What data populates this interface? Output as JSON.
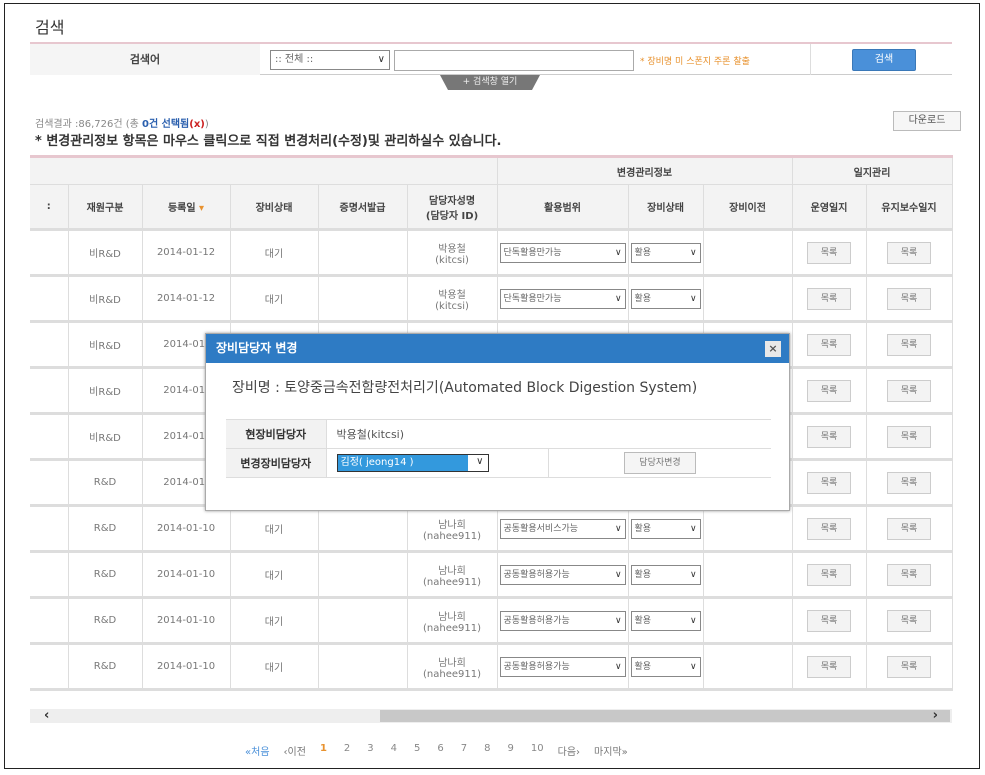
{
  "page_title": "검색",
  "search": {
    "label": "검색어",
    "scope": ":: 전체 ::",
    "value": "",
    "hint": "* 장비명 미 스폰지 주론 찰출",
    "button": "검색",
    "toggle": "+ 검색창 열기"
  },
  "result": {
    "prefix": "검색결과 :86,726건 (총 ",
    "count": "0건 선택됨",
    "x": "(x)",
    "suffix": ")"
  },
  "note": "* 변경관리정보 항목은 마우스 클릭으로 직접 변경처리(수정)및 관리하실수 있습니다.",
  "download": "다운로드",
  "table": {
    "groups": {
      "change": "변경관리정보",
      "log": "일지관리"
    },
    "columns": [
      "재원구분",
      "등록일",
      "장비상태",
      "증명서발급",
      "담당자성명",
      "(담당자 ID)",
      "활용범위",
      "장비상태",
      "장비이전",
      "운영일지",
      "유지보수일지"
    ],
    "sort_icon": "▾",
    "log_button": "목록",
    "rows": [
      {
        "fund": "비R&D",
        "date": "2014-01-12",
        "status": "대기",
        "name": "박용철",
        "id": "(kitcsi)",
        "scope": "단독활용만가능",
        "state": "활용"
      },
      {
        "fund": "비R&D",
        "date": "2014-01-12",
        "status": "대기",
        "name": "박용철",
        "id": "(kitcsi)",
        "scope": "단독활용만가능",
        "state": "활용"
      },
      {
        "fund": "비R&D",
        "date": "2014-01-",
        "status": "",
        "name": "",
        "id": "",
        "scope": "",
        "state": ""
      },
      {
        "fund": "비R&D",
        "date": "2014-01-",
        "status": "",
        "name": "",
        "id": "",
        "scope": "",
        "state": ""
      },
      {
        "fund": "비R&D",
        "date": "2014-01-",
        "status": "",
        "name": "",
        "id": "",
        "scope": "",
        "state": ""
      },
      {
        "fund": "R&D",
        "date": "2014-01-",
        "status": "",
        "name": "",
        "id": "",
        "scope": "",
        "state": ""
      },
      {
        "fund": "R&D",
        "date": "2014-01-10",
        "status": "대기",
        "name": "남나희",
        "id": "(nahee911)",
        "scope": "공동활용서비스가능",
        "state": "활용"
      },
      {
        "fund": "R&D",
        "date": "2014-01-10",
        "status": "대기",
        "name": "남나희",
        "id": "(nahee911)",
        "scope": "공동활용허용가능",
        "state": "활용"
      },
      {
        "fund": "R&D",
        "date": "2014-01-10",
        "status": "대기",
        "name": "남나희",
        "id": "(nahee911)",
        "scope": "공동활용허용가능",
        "state": "활용"
      },
      {
        "fund": "R&D",
        "date": "2014-01-10",
        "status": "대기",
        "name": "남나희",
        "id": "(nahee911)",
        "scope": "공동활용허용가능",
        "state": "활용"
      }
    ]
  },
  "pager": {
    "first": "«처음",
    "prev": "‹이전",
    "pages": [
      "1",
      "2",
      "3",
      "4",
      "5",
      "6",
      "7",
      "8",
      "9",
      "10"
    ],
    "current": "1",
    "next": "다음›",
    "last": "마지막»"
  },
  "modal": {
    "title": "장비담당자 변경",
    "close": "×",
    "equip_name": "장비명 : 토양중금속전함량전처리기(Automated Block Digestion System)",
    "current_label": "현장비담당자",
    "current_value": "박용철(kitcsi)",
    "new_label": "변경장비담당자",
    "new_value": "김정( jeong14 )",
    "change_button": "담당자변경"
  },
  "colors": {
    "accent": "#2e7bc4",
    "button": "#4a90d9",
    "hint": "#e8922f",
    "header_border": "#e7c7cf"
  }
}
